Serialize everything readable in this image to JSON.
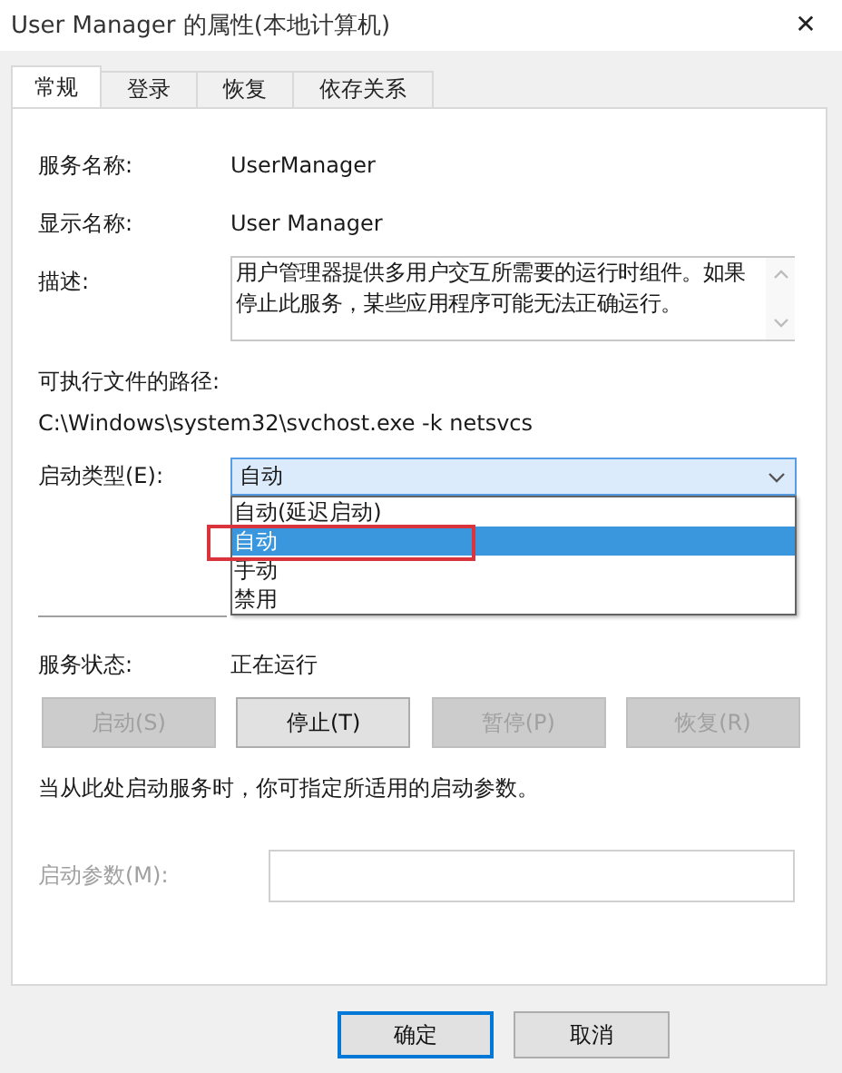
{
  "window": {
    "title": "User Manager 的属性(本地计算机)",
    "close": "✕"
  },
  "tabs": [
    {
      "label": "常规",
      "selected": true
    },
    {
      "label": "登录",
      "selected": false
    },
    {
      "label": "恢复",
      "selected": false
    },
    {
      "label": "依存关系",
      "selected": false
    }
  ],
  "service_name": {
    "label": "服务名称:",
    "value": "UserManager"
  },
  "display_name": {
    "label": "显示名称:",
    "value": "User Manager"
  },
  "description": {
    "label": "描述:",
    "value": "用户管理器提供多用户交互所需要的运行时组件。如果停止此服务，某些应用程序可能无法正确运行。"
  },
  "executable_path": {
    "label": "可执行文件的路径:",
    "value": "C:\\Windows\\system32\\svchost.exe -k netsvcs"
  },
  "startup_type": {
    "label": "启动类型(E):",
    "value": "自动",
    "expanded": true,
    "options": [
      {
        "label": "自动(延迟启动)",
        "selected": false,
        "highlighted": false
      },
      {
        "label": "自动",
        "selected": true,
        "highlighted": true
      },
      {
        "label": "手动",
        "selected": false,
        "highlighted": false
      },
      {
        "label": "禁用",
        "selected": false,
        "highlighted": false
      }
    ]
  },
  "service_status": {
    "label": "服务状态:",
    "value": "正在运行"
  },
  "service_buttons": [
    {
      "label": "启动(S)",
      "disabled": true
    },
    {
      "label": "停止(T)",
      "disabled": false
    },
    {
      "label": "暂停(P)",
      "disabled": true
    },
    {
      "label": "恢复(R)",
      "disabled": true
    }
  ],
  "hint": "当从此处启动服务时，你可指定所适用的启动参数。",
  "start_parameters": {
    "label": "启动参数(M):",
    "disabled": true
  },
  "dialog_buttons": [
    {
      "label": "确定",
      "default": true
    },
    {
      "label": "取消",
      "default": false
    }
  ]
}
